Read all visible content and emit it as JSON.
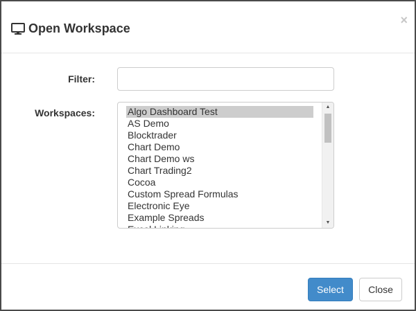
{
  "dialog": {
    "title": "Open Workspace",
    "title_icon": "monitor-icon",
    "close_glyph": "×"
  },
  "form": {
    "filter_label": "Filter:",
    "filter_value": "",
    "workspaces_label": "Workspaces:"
  },
  "workspaces": {
    "selected": "Algo Dashboard Test",
    "items": [
      "Algo Dashboard Test",
      "AS Demo",
      "Blocktrader",
      "Chart Demo",
      "Chart Demo ws",
      "Chart Trading2",
      "Cocoa",
      "Custom Spread Formulas",
      "Electronic Eye",
      "Example Spreads",
      "Excel Linking"
    ]
  },
  "footer": {
    "select_label": "Select",
    "close_label": "Close"
  },
  "colors": {
    "primary": "#428bca",
    "selected_row": "#cdcdcd"
  }
}
